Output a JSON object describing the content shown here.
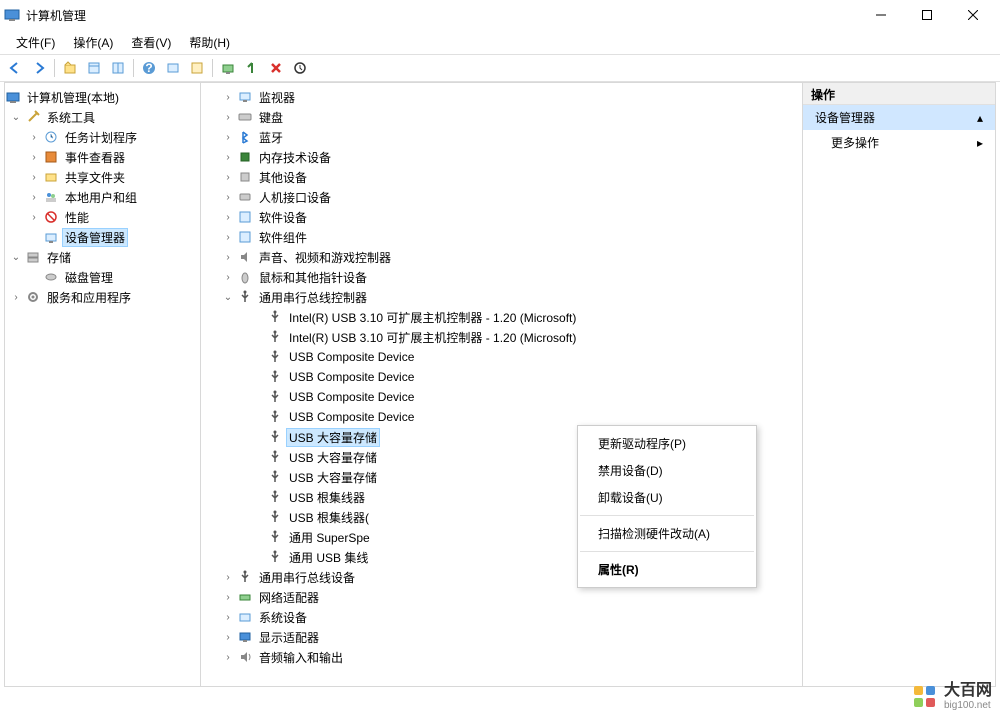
{
  "window": {
    "title": "计算机管理"
  },
  "menus": {
    "file": "文件(F)",
    "action": "操作(A)",
    "view": "查看(V)",
    "help": "帮助(H)"
  },
  "left_tree": {
    "root": "计算机管理(本地)",
    "sys_tools": "系统工具",
    "task_sched": "任务计划程序",
    "event_viewer": "事件查看器",
    "shared_folders": "共享文件夹",
    "local_users": "本地用户和组",
    "performance": "性能",
    "device_manager": "设备管理器",
    "storage": "存储",
    "disk_mgmt": "磁盘管理",
    "services_apps": "服务和应用程序"
  },
  "devices": {
    "monitor": "监视器",
    "keyboard": "键盘",
    "bluetooth": "蓝牙",
    "memory": "内存技术设备",
    "other": "其他设备",
    "hid": "人机接口设备",
    "software_dev": "软件设备",
    "software_comp": "软件组件",
    "sound": "声音、视频和游戏控制器",
    "mouse": "鼠标和其他指针设备",
    "usb_ctrl": "通用串行总线控制器",
    "usb_intel1": "Intel(R) USB 3.10 可扩展主机控制器 - 1.20 (Microsoft)",
    "usb_intel2": "Intel(R) USB 3.10 可扩展主机控制器 - 1.20 (Microsoft)",
    "usb_comp1": "USB Composite Device",
    "usb_comp2": "USB Composite Device",
    "usb_comp3": "USB Composite Device",
    "usb_comp4": "USB Composite Device",
    "usb_mass1": "USB 大容量存储",
    "usb_mass2": "USB 大容量存储",
    "usb_mass3": "USB 大容量存储",
    "usb_hub1": "USB 根集线器",
    "usb_hub2": "USB 根集线器(",
    "usb_super": "通用 SuperSpe",
    "usb_generic_hub": "通用 USB 集线",
    "usb_bus_dev": "通用串行总线设备",
    "network": "网络适配器",
    "system": "系统设备",
    "display": "显示适配器",
    "audio_io": "音频输入和输出"
  },
  "context_menu": {
    "update_driver": "更新驱动程序(P)",
    "disable_device": "禁用设备(D)",
    "uninstall_device": "卸载设备(U)",
    "scan_hardware": "扫描检测硬件改动(A)",
    "properties": "属性(R)"
  },
  "right_pane": {
    "header": "操作",
    "device_manager": "设备管理器",
    "more_actions": "更多操作"
  },
  "watermark": {
    "main": "大百网",
    "sub": "big100.net"
  }
}
